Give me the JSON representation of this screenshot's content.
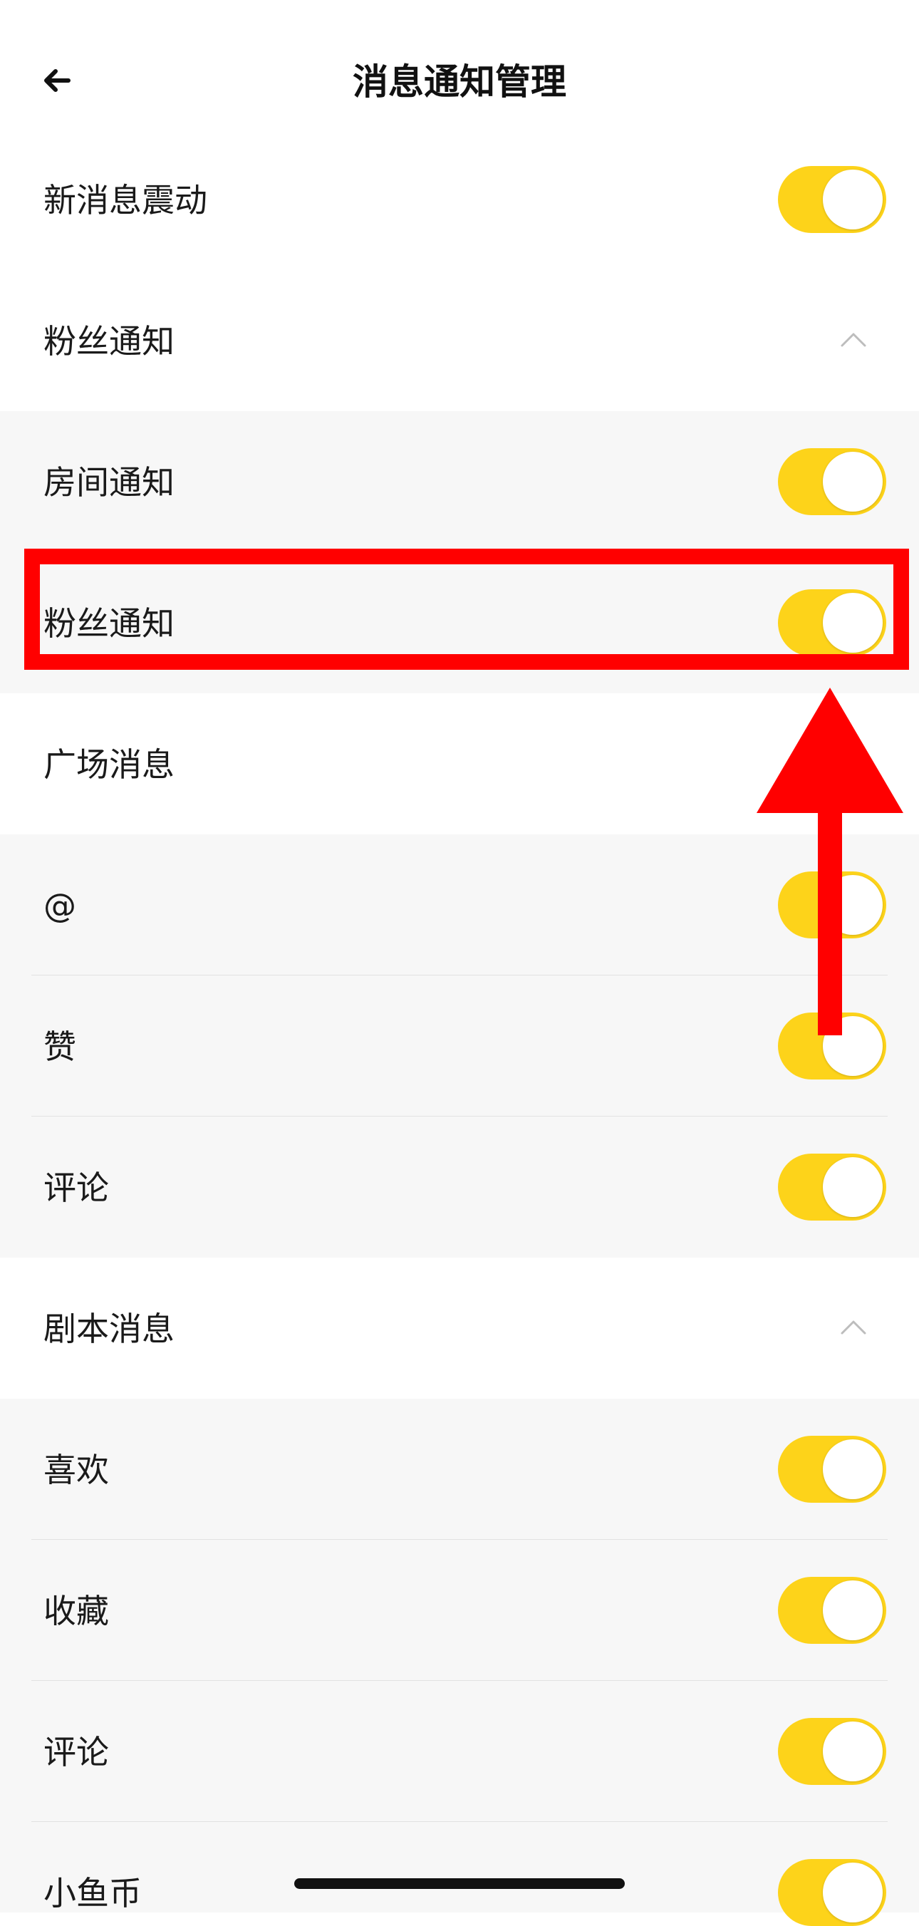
{
  "header": {
    "title": "消息通知管理",
    "back_icon": "arrow-left-icon"
  },
  "rows": [
    {
      "label": "新消息震动",
      "control": "toggle",
      "state": "on"
    },
    {
      "label": "粉丝通知",
      "control": "chevron-up",
      "state": "expanded"
    },
    {
      "label": "房间通知",
      "control": "toggle",
      "state": "on"
    },
    {
      "label": "粉丝通知",
      "control": "toggle",
      "state": "on"
    },
    {
      "label": "广场消息",
      "control": "chevron-up",
      "state": "expanded"
    },
    {
      "label": "@",
      "control": "toggle",
      "state": "on"
    },
    {
      "label": "赞",
      "control": "toggle",
      "state": "on"
    },
    {
      "label": "评论",
      "control": "toggle",
      "state": "on"
    },
    {
      "label": "剧本消息",
      "control": "chevron-up",
      "state": "expanded"
    },
    {
      "label": "喜欢",
      "control": "toggle",
      "state": "on"
    },
    {
      "label": "收藏",
      "control": "toggle",
      "state": "on"
    },
    {
      "label": "评论",
      "control": "toggle",
      "state": "on"
    },
    {
      "label": "小鱼币",
      "control": "toggle",
      "state": "on"
    }
  ],
  "colors": {
    "toggle_on": "#fdd31a",
    "annotation": "#ff0000",
    "subsection_background": "#f7f7f7"
  },
  "annotations": {
    "highlight": "red-highlight-box",
    "arrow": "red-up-arrow-icon"
  }
}
